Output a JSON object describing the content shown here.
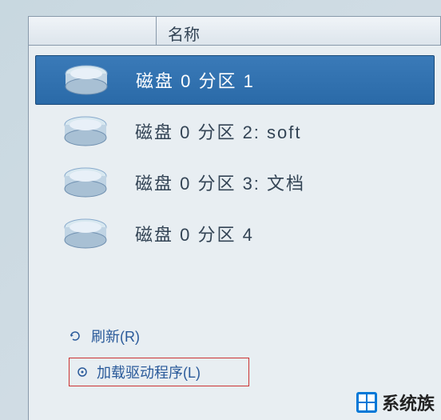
{
  "header": {
    "name_col": "名称"
  },
  "partitions": [
    {
      "label": "磁盘 0 分区 1",
      "selected": true
    },
    {
      "label": "磁盘 0 分区 2: soft",
      "selected": false
    },
    {
      "label": "磁盘 0 分区 3: 文档",
      "selected": false
    },
    {
      "label": "磁盘 0 分区 4",
      "selected": false
    }
  ],
  "links": {
    "refresh": "刷新(R)",
    "load_driver": "加载驱动程序(L)"
  },
  "watermark": {
    "text": "系统族"
  }
}
